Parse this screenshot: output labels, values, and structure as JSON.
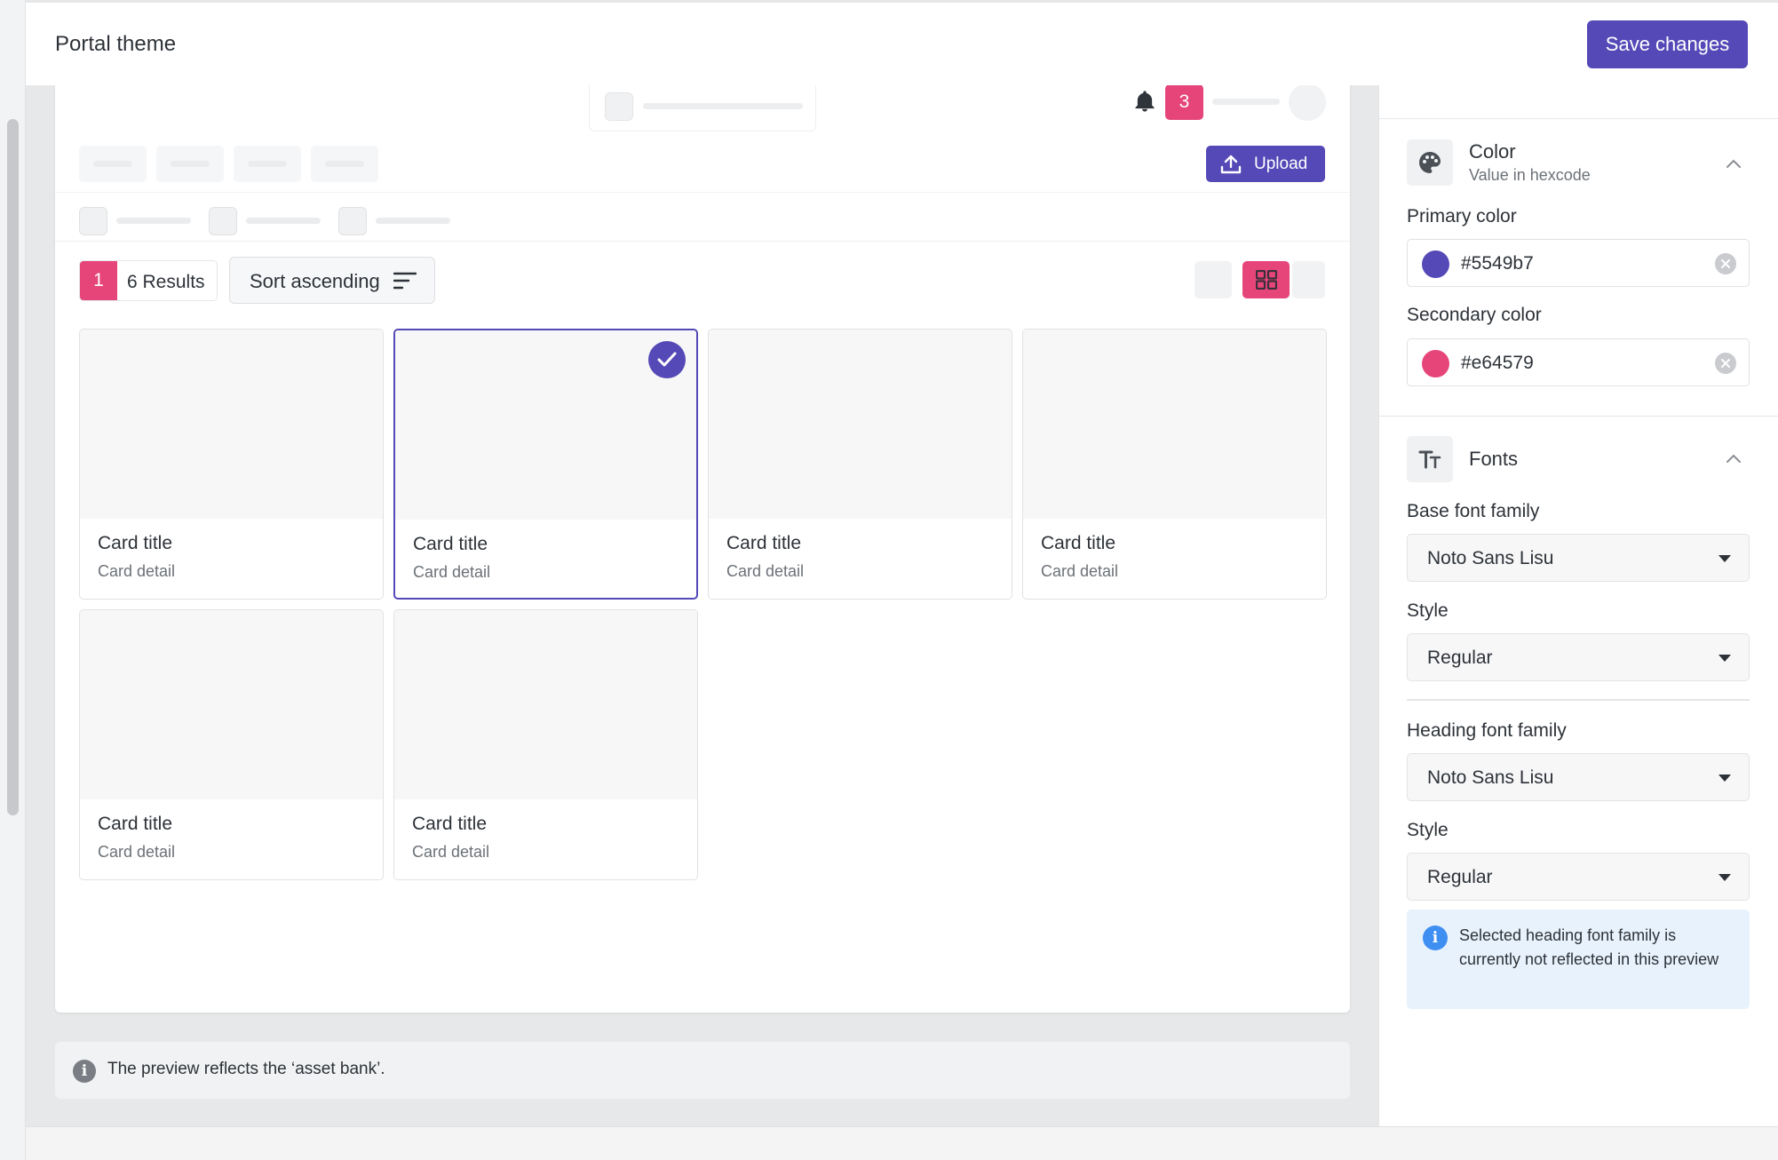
{
  "header": {
    "title": "Portal theme",
    "save_label": "Save changes"
  },
  "preview": {
    "notification_count": "3",
    "upload_label": "Upload",
    "results_count": "1",
    "results_label": "6 Results",
    "sort_label": "Sort ascending",
    "cards": [
      {
        "title": "Card title",
        "detail": "Card detail",
        "selected": false
      },
      {
        "title": "Card title",
        "detail": "Card detail",
        "selected": true
      },
      {
        "title": "Card title",
        "detail": "Card detail",
        "selected": false
      },
      {
        "title": "Card title",
        "detail": "Card detail",
        "selected": false
      },
      {
        "title": "Card title",
        "detail": "Card detail",
        "selected": false
      },
      {
        "title": "Card title",
        "detail": "Card detail",
        "selected": false
      }
    ]
  },
  "info_bar": {
    "message": "The preview reflects the ‘asset bank’."
  },
  "panel": {
    "color_section": {
      "title": "Color",
      "subtitle": "Value in hexcode",
      "primary_label": "Primary color",
      "primary_value": "#5549b7",
      "secondary_label": "Secondary color",
      "secondary_value": "#e64579"
    },
    "fonts_section": {
      "title": "Fonts",
      "base_label": "Base font family",
      "base_value": "Noto Sans Lisu",
      "base_style_label": "Style",
      "base_style_value": "Regular",
      "heading_label": "Heading font family",
      "heading_value": "Noto Sans Lisu",
      "heading_style_label": "Style",
      "heading_style_value": "Regular",
      "note": "Selected heading font family is currently not reflected in this preview"
    }
  },
  "colors": {
    "primary": "#5549b7",
    "secondary": "#e64579"
  },
  "icons": [
    "bell-icon",
    "upload-icon",
    "sort-icon",
    "grid-view-icon",
    "check-icon",
    "info-icon",
    "palette-icon",
    "text-size-icon",
    "chevron-up-icon",
    "clear-icon",
    "dropdown-caret-icon"
  ]
}
